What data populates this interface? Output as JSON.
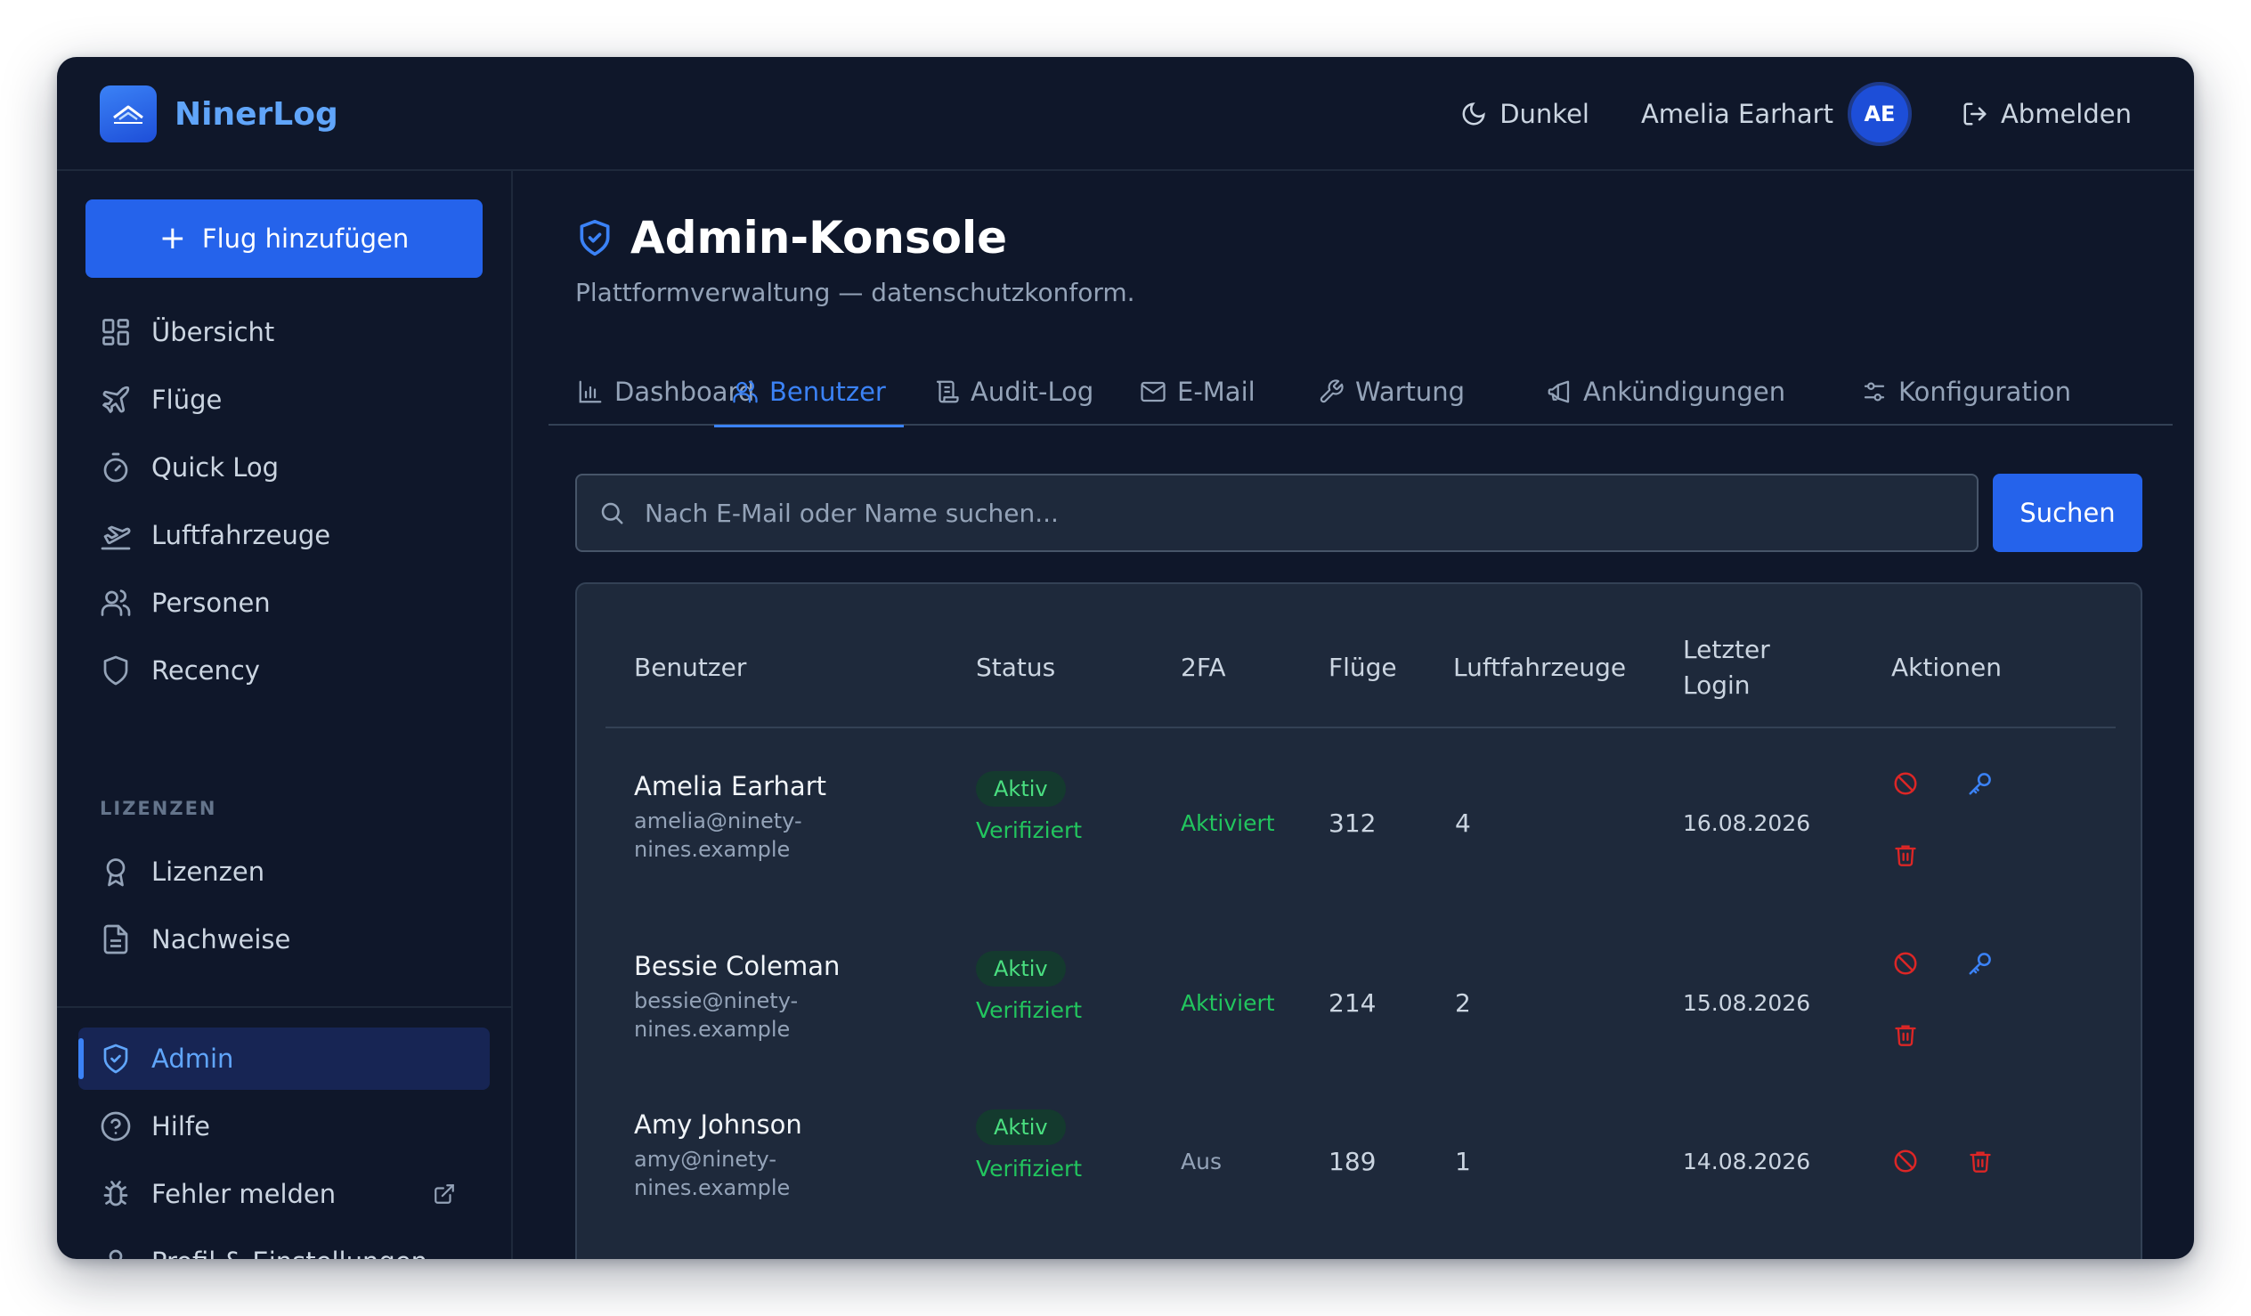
{
  "header": {
    "brand": "NinerLog",
    "theme_label": "Dunkel",
    "user_name": "Amelia Earhart",
    "avatar_initials": "AE",
    "logout_label": "Abmelden"
  },
  "sidebar": {
    "add_button": "Flug hinzufügen",
    "items": [
      {
        "label": "Übersicht",
        "icon": "grid-icon"
      },
      {
        "label": "Flüge",
        "icon": "plane-icon"
      },
      {
        "label": "Quick Log",
        "icon": "stopwatch-icon"
      },
      {
        "label": "Luftfahrzeuge",
        "icon": "plane-departure-icon"
      },
      {
        "label": "Personen",
        "icon": "users-icon"
      },
      {
        "label": "Recency",
        "icon": "shield-icon"
      }
    ],
    "section_label": "LIZENZEN",
    "license_items": [
      {
        "label": "Lizenzen",
        "icon": "award-icon"
      },
      {
        "label": "Nachweise",
        "icon": "document-icon"
      }
    ],
    "bottom_items": [
      {
        "label": "Admin",
        "icon": "shield-check-icon"
      },
      {
        "label": "Hilfe",
        "icon": "help-circle-icon"
      },
      {
        "label": "Fehler melden",
        "icon": "bug-icon"
      },
      {
        "label": "Profil & Einstellungen",
        "icon": "user-icon"
      }
    ]
  },
  "main": {
    "title": "Admin-Konsole",
    "subtitle": "Plattformverwaltung — datenschutzkonform.",
    "tabs": [
      {
        "label": "Dashboard",
        "icon": "bar-chart-icon"
      },
      {
        "label": "Benutzer",
        "icon": "users-icon"
      },
      {
        "label": "Audit-Log",
        "icon": "scroll-icon"
      },
      {
        "label": "E-Mail",
        "icon": "mail-icon"
      },
      {
        "label": "Wartung",
        "icon": "wrench-icon"
      },
      {
        "label": "Ankündigungen",
        "icon": "megaphone-icon"
      },
      {
        "label": "Konfiguration",
        "icon": "settings-sliders-icon"
      }
    ],
    "active_tab": "Benutzer",
    "search": {
      "placeholder": "Nach E-Mail oder Name suchen...",
      "value": "",
      "button": "Suchen"
    },
    "table": {
      "headers": {
        "user": "Benutzer",
        "status": "Status",
        "twofa": "2FA",
        "flights": "Flüge",
        "aircraft": "Luftfahrzeuge",
        "last_login_1": "Letzter",
        "last_login_2": "Login",
        "actions": "Aktionen"
      },
      "rows": [
        {
          "name": "Amelia Earhart",
          "email_1": "amelia@ninety-",
          "email_2": "nines.example",
          "status": "Aktiv",
          "verified": "Verifiziert",
          "twofa": "Aktiviert",
          "flights": "312",
          "aircraft": "4",
          "last_login": "16.08.2026"
        },
        {
          "name": "Bessie Coleman",
          "email_1": "bessie@ninety-",
          "email_2": "nines.example",
          "status": "Aktiv",
          "verified": "Verifiziert",
          "twofa": "Aktiviert",
          "flights": "214",
          "aircraft": "2",
          "last_login": "15.08.2026"
        },
        {
          "name": "Amy Johnson",
          "email_1": "amy@ninety-",
          "email_2": "nines.example",
          "status": "Aktiv",
          "verified": "Verifiziert",
          "twofa": "Aus",
          "flights": "189",
          "aircraft": "1",
          "last_login": "14.08.2026"
        }
      ]
    }
  },
  "colors": {
    "background": "#0f172a",
    "surface": "#1e293b",
    "accent": "#2563eb",
    "success": "#22c55e",
    "danger": "#dc2626"
  }
}
